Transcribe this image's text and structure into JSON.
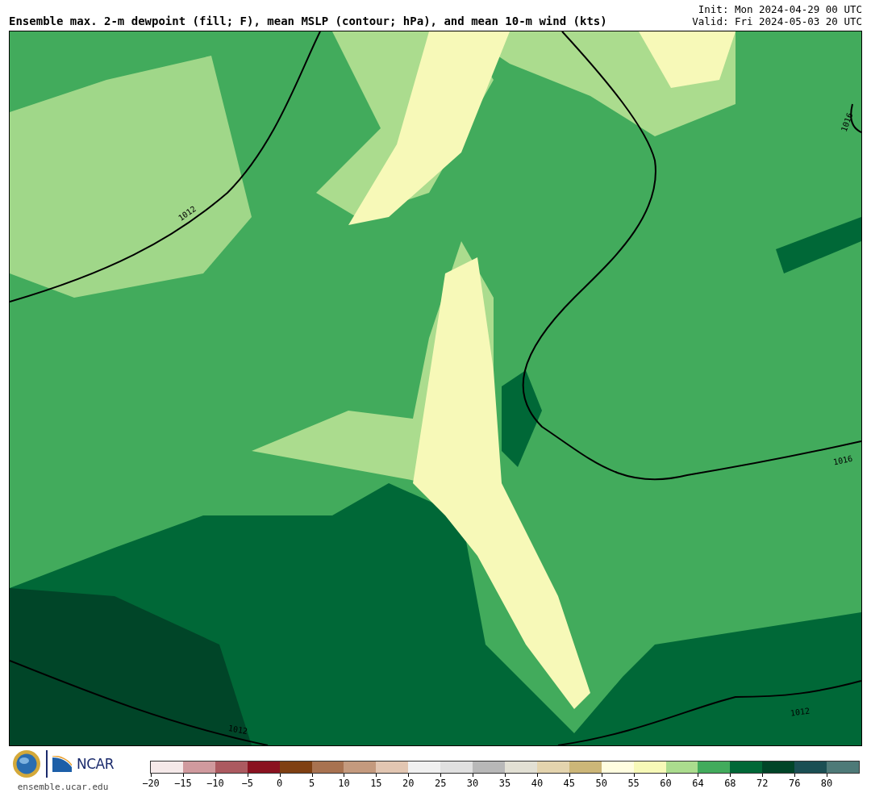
{
  "title": "Ensemble max. 2-m dewpoint (fill; F), mean MSLP (contour; hPa), and mean 10-m wind (kts)",
  "init": "Init: Mon 2024-04-29 00 UTC",
  "valid": "Valid: Fri 2024-05-03 20 UTC",
  "map": {
    "contour_labels": [
      "1012",
      "1016",
      "1016",
      "1012",
      "1012"
    ]
  },
  "logos": {
    "ncar": "NCAR",
    "url": "ensemble.ucar.edu"
  },
  "colorbar": {
    "bins": [
      {
        "color": "#f5e9e9"
      },
      {
        "color": "#d09a9e"
      },
      {
        "color": "#ac5a60"
      },
      {
        "color": "#8a1220"
      },
      {
        "color": "#7f4012"
      },
      {
        "color": "#a87250"
      },
      {
        "color": "#c49a7e"
      },
      {
        "color": "#e2c6b2"
      },
      {
        "color": "#f0f0f0"
      },
      {
        "color": "#e0e0e0"
      },
      {
        "color": "#b8b8b8"
      },
      {
        "color": "#e2e0d4"
      },
      {
        "color": "#e4d4ae"
      },
      {
        "color": "#ccb678"
      },
      {
        "color": "#fffde0"
      },
      {
        "color": "#f7f9b8"
      },
      {
        "color": "#abdc8e"
      },
      {
        "color": "#42ab5c"
      },
      {
        "color": "#006837"
      },
      {
        "color": "#004528"
      },
      {
        "color": "#1b4f54"
      },
      {
        "color": "#4e7a78"
      }
    ],
    "ticks": [
      "−20",
      "−15",
      "−10",
      "−5",
      "0",
      "5",
      "10",
      "15",
      "20",
      "25",
      "30",
      "35",
      "40",
      "45",
      "50",
      "55",
      "60",
      "64",
      "68",
      "72",
      "76",
      "80"
    ]
  }
}
